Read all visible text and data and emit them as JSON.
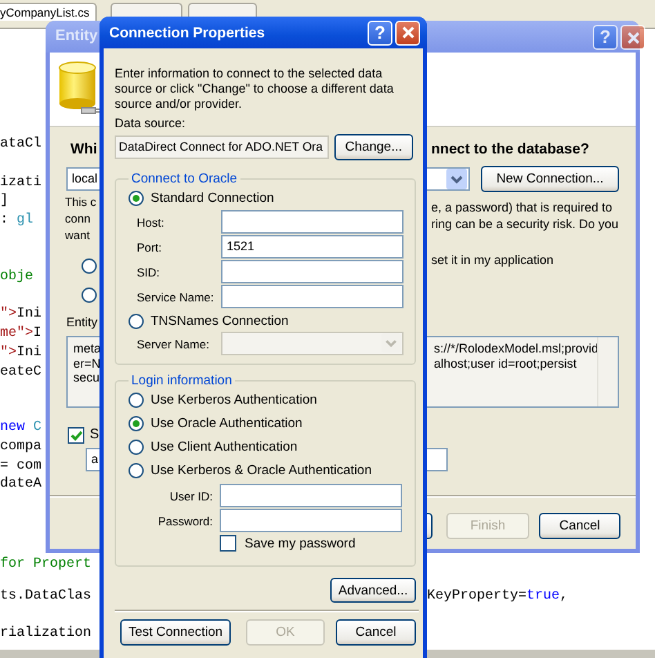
{
  "editor": {
    "tabs": [
      {
        "label": "yCompanyList.cs",
        "selected": true
      },
      {
        "selected": false
      },
      {
        "selected": false
      }
    ],
    "code_lines": [
      {
        "segments": [
          {
            "text": "ataCl",
            "kind": "plain"
          }
        ]
      },
      {
        "segments": [
          {
            "text": "izati",
            "kind": "plain"
          }
        ]
      },
      {
        "segments": [
          {
            "text": "]",
            "kind": "plain"
          }
        ]
      },
      {
        "segments": [
          {
            "text": ": ",
            "kind": "plain"
          },
          {
            "text": "gl",
            "kind": "type"
          }
        ]
      },
      {
        "segments": [
          {
            "text": "obje",
            "kind": "comment"
          }
        ]
      },
      {
        "segments": [
          {
            "text": "\">",
            "kind": "string"
          },
          {
            "text": "Ini",
            "kind": "plain"
          }
        ]
      },
      {
        "segments": [
          {
            "text": "me\">",
            "kind": "string"
          },
          {
            "text": "I",
            "kind": "plain"
          }
        ]
      },
      {
        "segments": [
          {
            "text": "\">",
            "kind": "string"
          },
          {
            "text": "Ini",
            "kind": "plain"
          }
        ]
      },
      {
        "segments": [
          {
            "text": "eateC",
            "kind": "plain"
          }
        ]
      },
      {
        "segments": [
          {
            "text": "new",
            "kind": "keyword"
          },
          {
            "text": " C",
            "kind": "type"
          }
        ]
      },
      {
        "segments": [
          {
            "text": "compa",
            "kind": "plain"
          }
        ]
      },
      {
        "segments": [
          {
            "text": "= com",
            "kind": "plain"
          }
        ]
      },
      {
        "segments": [
          {
            "text": "dateA",
            "kind": "plain"
          }
        ]
      },
      {
        "segments": [
          {
            "text": "for Propert",
            "kind": "comment"
          }
        ]
      },
      {
        "segments": [
          {
            "text": "ts.DataClas",
            "kind": "plain"
          }
        ]
      },
      {
        "segments": [
          {
            "text": "rialization",
            "kind": "plain"
          }
        ]
      }
    ],
    "code_lines_right": [
      {
        "segments": [
          {
            "text": "KeyProperty=",
            "kind": "plain"
          },
          {
            "text": "true",
            "kind": "keyword"
          },
          {
            "text": ",",
            "kind": "plain"
          }
        ]
      }
    ]
  },
  "entity_wizard": {
    "title": "Entity",
    "help_button": "?",
    "question_start": "Whi",
    "question_end": "nnect to the database?",
    "connection_combo": {
      "value": "local"
    },
    "new_connection_button": "New Connection...",
    "warning_left": [
      "This c",
      "conn",
      "want"
    ],
    "warning_right": [
      "e, a password) that is required to",
      "ring can be a security risk. Do you"
    ],
    "radio_options": [
      {
        "selected": false
      },
      {
        "selected": false
      }
    ],
    "option_right": "set it in my application",
    "entity_label": "Entity",
    "connection_string_left": [
      "meta",
      "er=N",
      "secu"
    ],
    "connection_string_right": [
      "s://*/RolodexModel.msl;provid",
      "alhost;user id=root;persist"
    ],
    "save_checkbox": {
      "label": "S",
      "checked": true
    },
    "name_field": {
      "value": "a"
    },
    "buttons": [
      {
        "label": "Finish",
        "disabled": true
      },
      {
        "label": "Cancel",
        "disabled": false
      }
    ]
  },
  "connection_dialog": {
    "title": "Connection Properties",
    "help_button": "?",
    "intro": "Enter information to connect to the selected data source or click \"Change\" to choose a different data source and/or provider.",
    "data_source": {
      "label": "Data source:",
      "value": "DataDirect Connect for ADO.NET Ora"
    },
    "change_button": "Change...",
    "connect_group": {
      "legend": "Connect to Oracle",
      "modes": [
        {
          "label": "Standard Connection",
          "selected": true
        },
        {
          "label": "TNSNames Connection",
          "selected": false
        }
      ],
      "standard_fields": [
        {
          "label": "Host:"
        },
        {
          "label": "Port:",
          "value": "1521"
        },
        {
          "label": "SID:"
        },
        {
          "label": "Service Name:"
        }
      ],
      "server_name": {
        "label": "Server Name:",
        "disabled": true
      }
    },
    "login_group": {
      "legend": "Login information",
      "methods": [
        {
          "label": "Use Kerberos Authentication",
          "selected": false
        },
        {
          "label": "Use Oracle Authentication",
          "selected": true
        },
        {
          "label": "Use Client Authentication",
          "selected": false
        },
        {
          "label": "Use Kerberos & Oracle Authentication",
          "selected": false
        }
      ],
      "fields": [
        {
          "label": "User ID:"
        },
        {
          "label": "Password:"
        }
      ],
      "save_password": {
        "label": "Save my password",
        "checked": false
      }
    },
    "advanced_button": "Advanced...",
    "buttons": [
      {
        "label": "Test Connection",
        "disabled": false
      },
      {
        "label": "OK",
        "disabled": true
      },
      {
        "label": "Cancel",
        "disabled": false
      }
    ]
  }
}
